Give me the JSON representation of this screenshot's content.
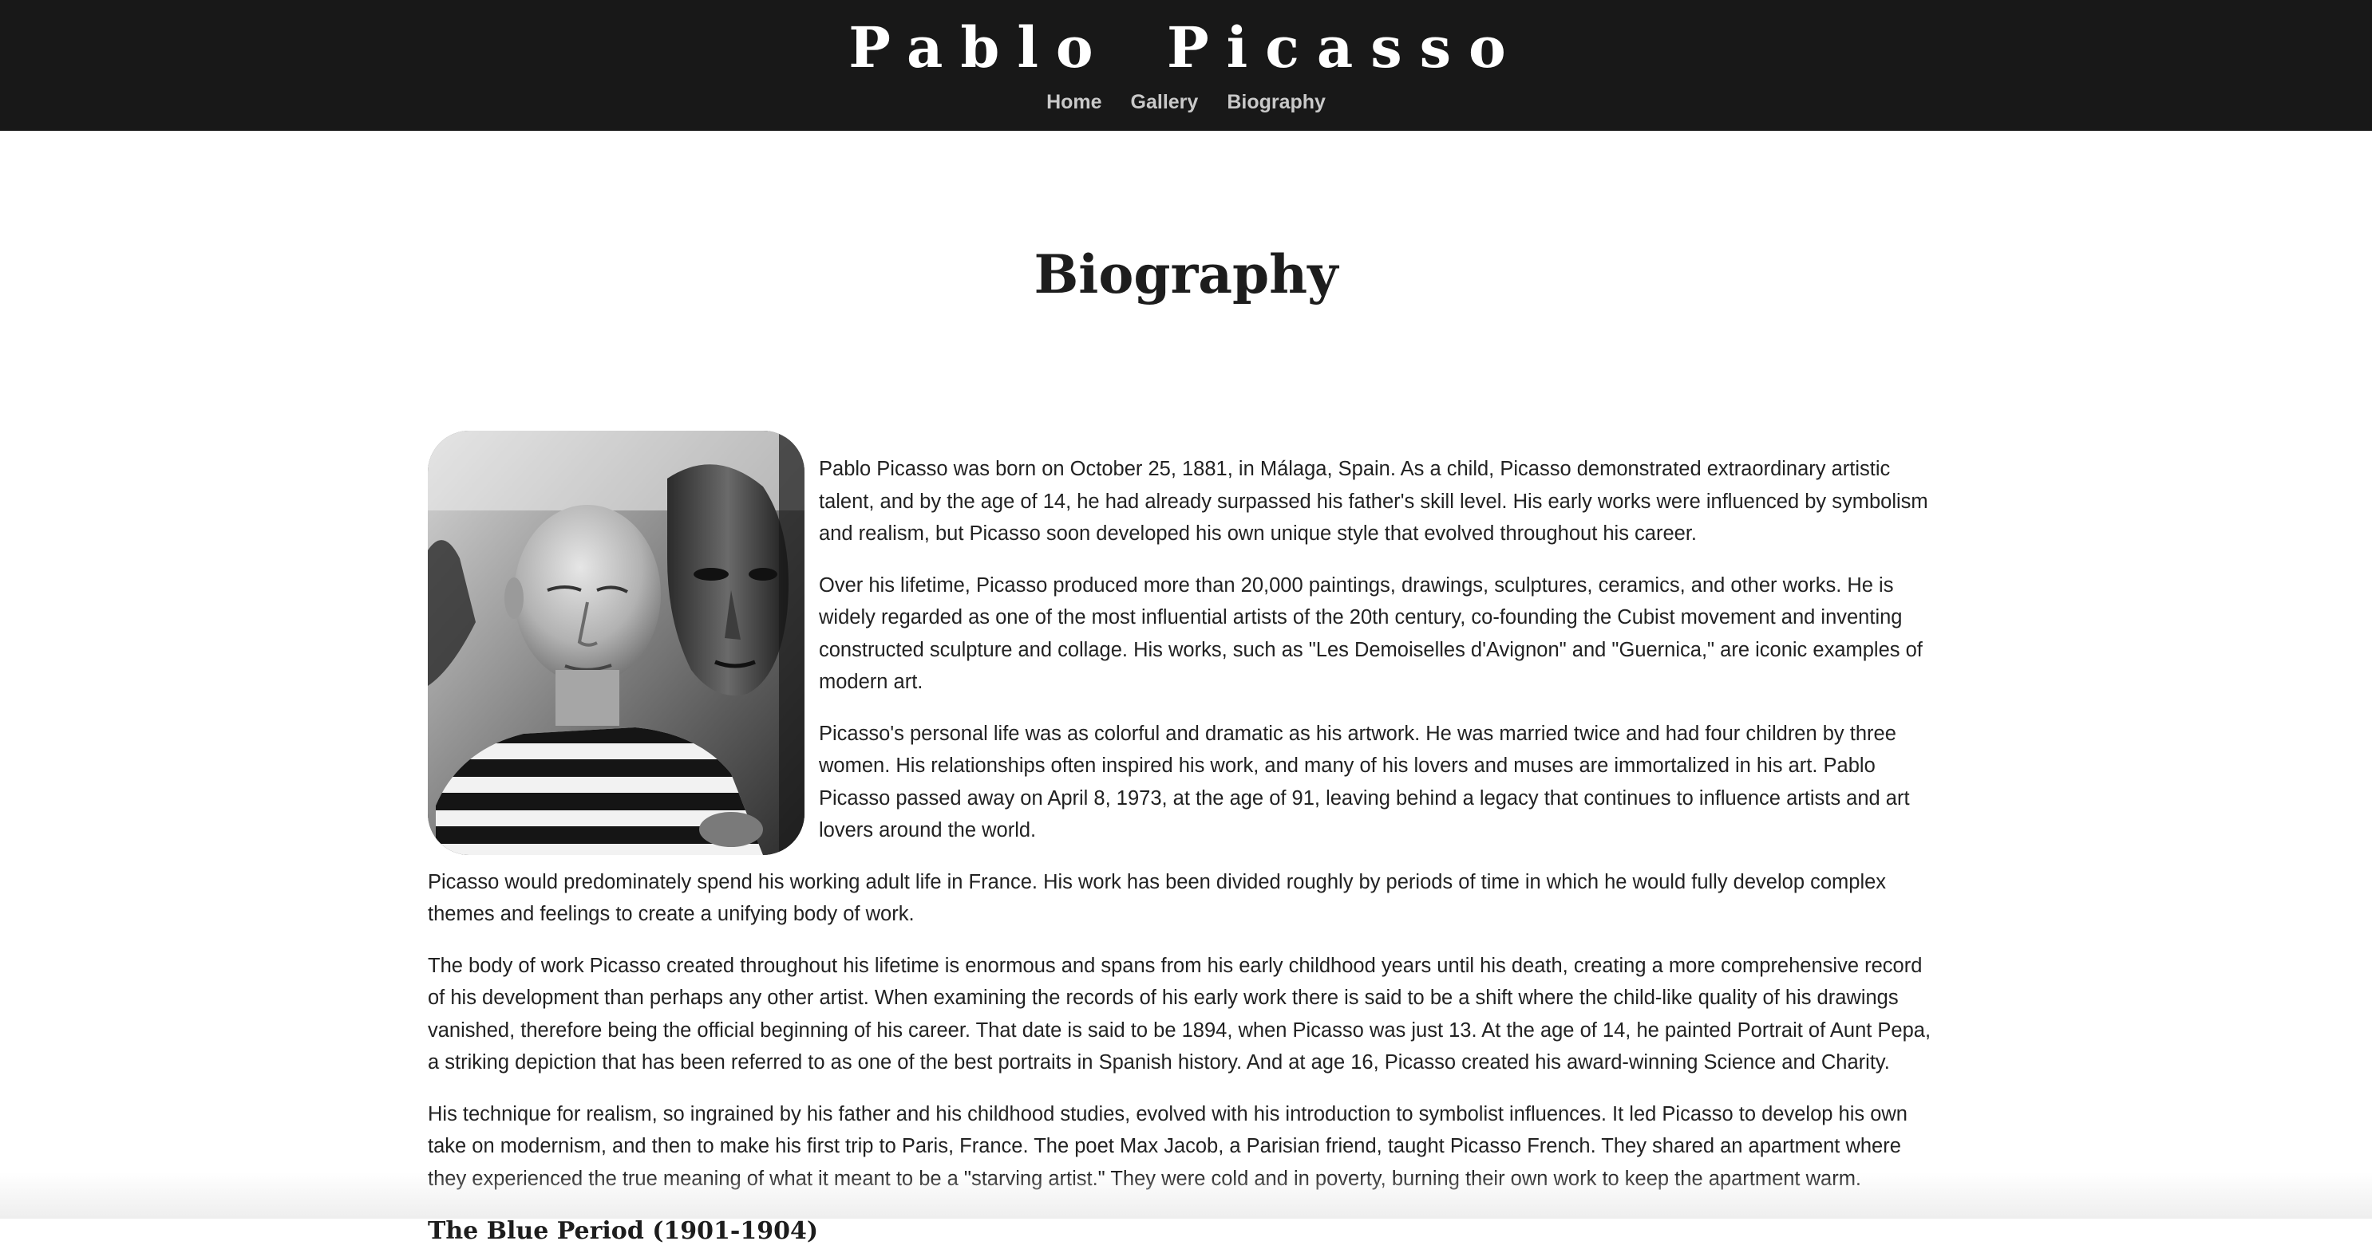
{
  "header": {
    "site_title": "Pablo Picasso",
    "nav": [
      {
        "label": "Home"
      },
      {
        "label": "Gallery"
      },
      {
        "label": "Biography"
      }
    ]
  },
  "main": {
    "title": "Biography",
    "portrait_icon": "portrait-photo",
    "paragraphs": [
      "Pablo Picasso was born on October 25, 1881, in Málaga, Spain. As a child, Picasso demonstrated extraordinary artistic talent, and by the age of 14, he had already surpassed his father's skill level. His early works were influenced by symbolism and realism, but Picasso soon developed his own unique style that evolved throughout his career.",
      "Over his lifetime, Picasso produced more than 20,000 paintings, drawings, sculptures, ceramics, and other works. He is widely regarded as one of the most influential artists of the 20th century, co-founding the Cubist movement and inventing constructed sculpture and collage. His works, such as \"Les Demoiselles d'Avignon\" and \"Guernica,\" are iconic examples of modern art.",
      "Picasso's personal life was as colorful and dramatic as his artwork. He was married twice and had four children by three women. His relationships often inspired his work, and many of his lovers and muses are immortalized in his art. Pablo Picasso passed away on April 8, 1973, at the age of 91, leaving behind a legacy that continues to influence artists and art lovers around the world.",
      "Picasso would predominately spend his working adult life in France. His work has been divided roughly by periods of time in which he would fully develop complex themes and feelings to create a unifying body of work.",
      "The body of work Picasso created throughout his lifetime is enormous and spans from his early childhood years until his death, creating a more comprehensive record of his development than perhaps any other artist. When examining the records of his early work there is said to be a shift where the child-like quality of his drawings vanished, therefore being the official beginning of his career. That date is said to be 1894, when Picasso was just 13. At the age of 14, he painted Portrait of Aunt Pepa, a striking depiction that has been referred to as one of the best portraits in Spanish history. And at age 16, Picasso created his award-winning Science and Charity.",
      "His technique for realism, so ingrained by his father and his childhood studies, evolved with his introduction to symbolist influences. It led Picasso to develop his own take on modernism, and then to make his first trip to Paris, France. The poet Max Jacob, a Parisian friend, taught Picasso French. They shared an apartment where they experienced the true meaning of what it meant to be a \"starving artist.\" They were cold and in poverty, burning their own work to keep the apartment warm."
    ],
    "section_heading": "The Blue Period (1901-1904)"
  },
  "colors": {
    "header_bg": "#181818",
    "header_text": "#ffffff",
    "nav_text": "#c9c9c9",
    "body_text": "#222222",
    "page_bg": "#ffffff"
  }
}
